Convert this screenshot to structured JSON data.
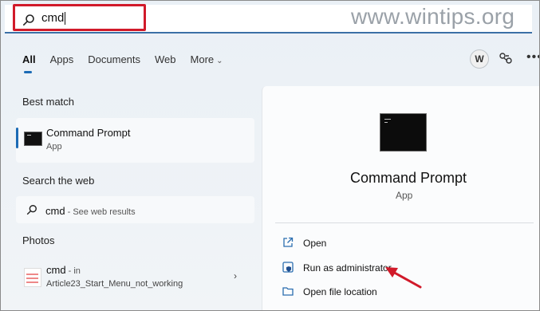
{
  "search": {
    "value": "cmd"
  },
  "watermark": "www.wintips.org",
  "tabs": [
    {
      "label": "All",
      "active": true
    },
    {
      "label": "Apps"
    },
    {
      "label": "Documents"
    },
    {
      "label": "Web"
    },
    {
      "label": "More"
    }
  ],
  "account": {
    "initial": "W"
  },
  "best_match": {
    "heading": "Best match",
    "title": "Command Prompt",
    "subtitle": "App"
  },
  "search_web": {
    "heading": "Search the web",
    "query": "cmd",
    "suffix": " - See web results"
  },
  "photos": {
    "heading": "Photos",
    "title": "cmd",
    "in_label": " - in",
    "subtitle": "Article23_Start_Menu_not_working"
  },
  "right_panel": {
    "title": "Command Prompt",
    "subtitle": "App",
    "actions": [
      {
        "label": "Open",
        "icon": "open-external-icon"
      },
      {
        "label": "Run as administrator",
        "icon": "shield-icon"
      },
      {
        "label": "Open file location",
        "icon": "folder-icon"
      }
    ]
  },
  "colors": {
    "highlight": "#d11a2a",
    "accent": "#1c6bb5"
  },
  "icons": [
    "search-icon",
    "share-icon",
    "more-icon",
    "chevron-down-icon",
    "chevron-right-icon",
    "cmd-icon"
  ]
}
